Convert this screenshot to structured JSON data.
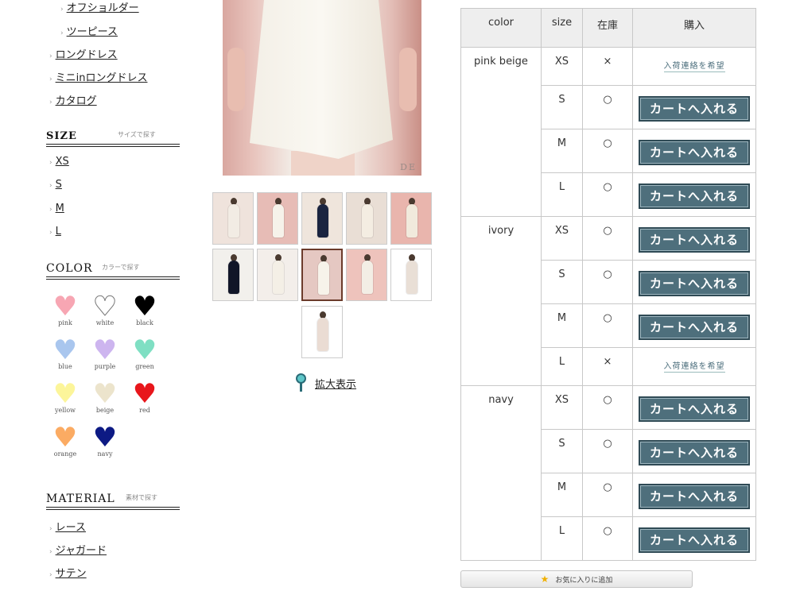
{
  "sidebar": {
    "categories_top": [
      {
        "label": "オフショルダー",
        "indent": true
      },
      {
        "label": "ツーピース",
        "indent": true
      },
      {
        "label": "ロングドレス",
        "indent": false
      },
      {
        "label": "ミニinロングドレス",
        "indent": false
      },
      {
        "label": "カタログ",
        "indent": false
      }
    ],
    "size": {
      "heading": "SIZE",
      "subheading": "サイズで探す",
      "items": [
        "XS",
        "S",
        "M",
        "L"
      ]
    },
    "color": {
      "heading": "COLOR",
      "subheading": "カラーで探す",
      "items": [
        {
          "name": "pink",
          "hex": "#f7a6b3"
        },
        {
          "name": "white",
          "hex": "#ffffff"
        },
        {
          "name": "black",
          "hex": "#000000"
        },
        {
          "name": "blue",
          "hex": "#a9c6ee"
        },
        {
          "name": "purple",
          "hex": "#cdb5ef"
        },
        {
          "name": "green",
          "hex": "#7fdfc3"
        },
        {
          "name": "yellow",
          "hex": "#fcf59a"
        },
        {
          "name": "beige",
          "hex": "#ece4cc"
        },
        {
          "name": "red",
          "hex": "#e8161b"
        },
        {
          "name": "orange",
          "hex": "#fbab63"
        },
        {
          "name": "navy",
          "hex": "#0d1a84"
        }
      ]
    },
    "material": {
      "heading": "MATERIAL",
      "subheading": "素材で探す",
      "items": [
        "レース",
        "ジャガード",
        "サテン"
      ]
    }
  },
  "gallery": {
    "watermark": "DE",
    "thumbnails": [
      {
        "dress": "#f2ece4",
        "bg": "#efe3dc"
      },
      {
        "dress": "#f6f2ea",
        "bg": "#e7bcb6"
      },
      {
        "dress": "#1a2440",
        "bg": "#efe5dc"
      },
      {
        "dress": "#f4ede2",
        "bg": "#e9ded5"
      },
      {
        "dress": "#f1eadc",
        "bg": "#e9b5ad"
      },
      {
        "dress": "#111628",
        "bg": "#f2f0ec"
      },
      {
        "dress": "#f4efe6",
        "bg": "#f3eeea"
      },
      {
        "dress": "#f7f3ea",
        "bg": "#e5c8c2"
      },
      {
        "dress": "#f3eee5",
        "bg": "#eec3bc"
      },
      {
        "dress": "#e9dfd6",
        "bg": "#ffffff"
      },
      {
        "dress": "#eadcd3",
        "bg": "#ffffff"
      }
    ],
    "selected_index": 7,
    "zoom_label": "拡大表示"
  },
  "stock_table": {
    "headers": [
      "color",
      "size",
      "在庫",
      "購入"
    ],
    "rows": [
      {
        "color": "pink beige",
        "size": "XS",
        "stock": "×",
        "action": "notify"
      },
      {
        "color": "",
        "size": "S",
        "stock": "○",
        "action": "cart"
      },
      {
        "color": "",
        "size": "M",
        "stock": "○",
        "action": "cart"
      },
      {
        "color": "",
        "size": "L",
        "stock": "○",
        "action": "cart"
      },
      {
        "color": "ivory",
        "size": "XS",
        "stock": "○",
        "action": "cart"
      },
      {
        "color": "",
        "size": "S",
        "stock": "○",
        "action": "cart"
      },
      {
        "color": "",
        "size": "M",
        "stock": "○",
        "action": "cart"
      },
      {
        "color": "",
        "size": "L",
        "stock": "×",
        "action": "notify"
      },
      {
        "color": "navy",
        "size": "XS",
        "stock": "○",
        "action": "cart"
      },
      {
        "color": "",
        "size": "S",
        "stock": "○",
        "action": "cart"
      },
      {
        "color": "",
        "size": "M",
        "stock": "○",
        "action": "cart"
      },
      {
        "color": "",
        "size": "L",
        "stock": "○",
        "action": "cart"
      }
    ],
    "cart_label": "カートへ入れる",
    "notify_label": "入荷連絡を希望"
  },
  "favorite_button": {
    "label": "お気に入りに追加",
    "icon": "star-icon"
  }
}
